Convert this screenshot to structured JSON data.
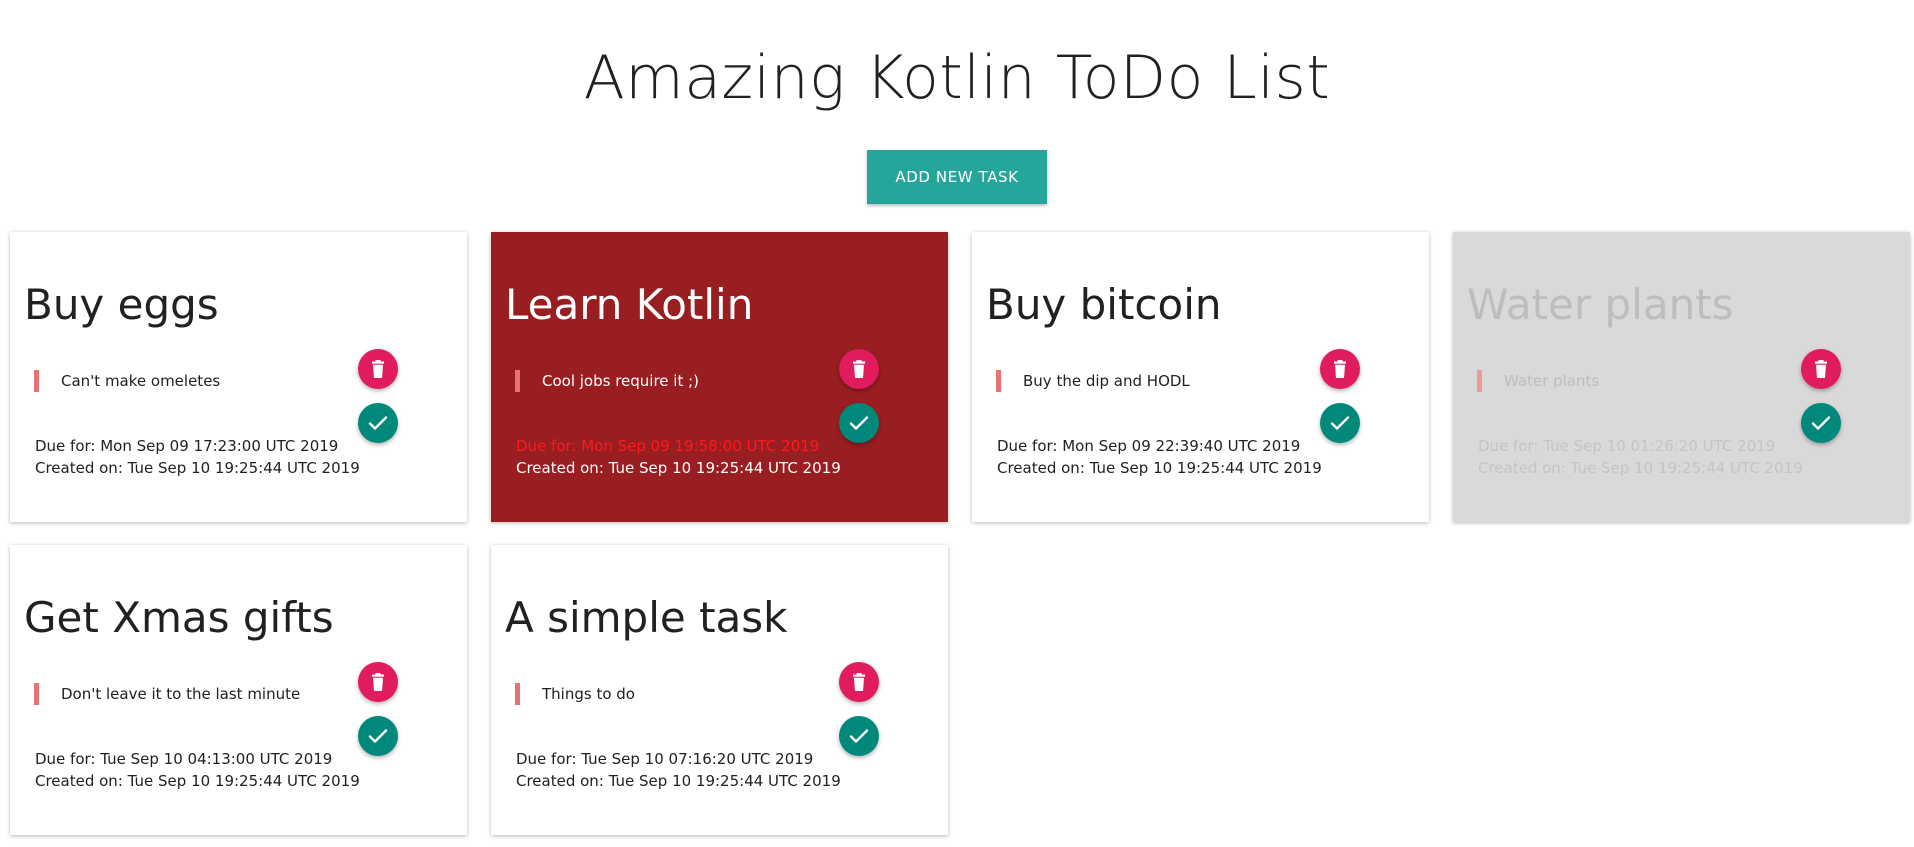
{
  "header": {
    "title": "Amazing Kotlin ToDo List",
    "add_button_label": "ADD NEW TASK"
  },
  "icons": {
    "delete": "trash-icon",
    "complete": "check-icon"
  },
  "colors": {
    "add_button": "#26a69a",
    "delete_button": "#e01c5c",
    "complete_button": "#00897b",
    "overdue_card": "#981e22",
    "done_card": "#d9d9d9",
    "description_bar": "#e57373"
  },
  "tasks": [
    {
      "title": "Buy eggs",
      "description": "Can't make omeletes",
      "due": "Due for: Mon Sep 09 17:23:00 UTC 2019",
      "created": "Created on: Tue Sep 10 19:25:44 UTC 2019",
      "state": "normal"
    },
    {
      "title": "Learn Kotlin",
      "description": "Cool jobs require it ;)",
      "due": "Due for: Mon Sep 09 19:58:00 UTC 2019",
      "created": "Created on: Tue Sep 10 19:25:44 UTC 2019",
      "state": "overdue"
    },
    {
      "title": "Buy bitcoin",
      "description": "Buy the dip and HODL",
      "due": "Due for: Mon Sep 09 22:39:40 UTC 2019",
      "created": "Created on: Tue Sep 10 19:25:44 UTC 2019",
      "state": "normal"
    },
    {
      "title": "Water plants",
      "description": "Water plants",
      "due": "Due for: Tue Sep 10 01:26:20 UTC 2019",
      "created": "Created on: Tue Sep 10 19:25:44 UTC 2019",
      "state": "done"
    },
    {
      "title": "Get Xmas gifts",
      "description": "Don't leave it to the last minute",
      "due": "Due for: Tue Sep 10 04:13:00 UTC 2019",
      "created": "Created on: Tue Sep 10 19:25:44 UTC 2019",
      "state": "normal"
    },
    {
      "title": "A simple task",
      "description": "Things to do",
      "due": "Due for: Tue Sep 10 07:16:20 UTC 2019",
      "created": "Created on: Tue Sep 10 19:25:44 UTC 2019",
      "state": "normal"
    }
  ]
}
